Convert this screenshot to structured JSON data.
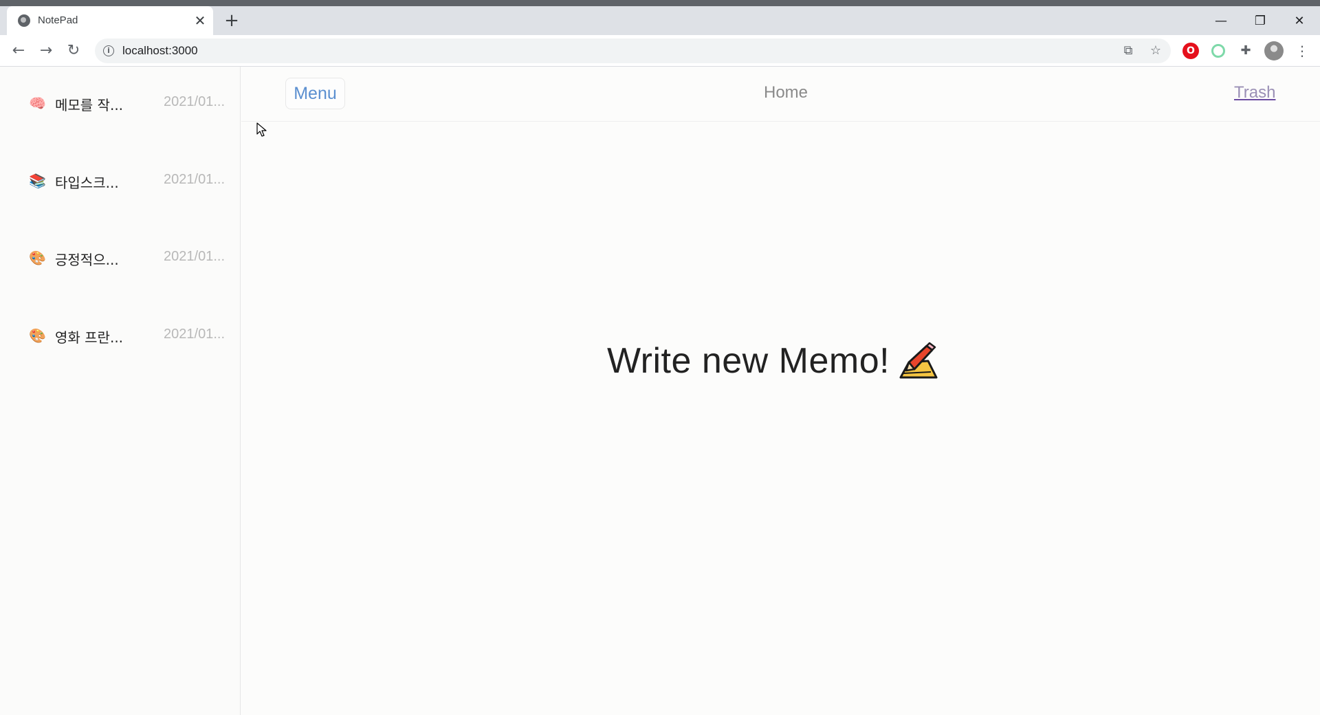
{
  "browser": {
    "tab_title": "NotePad",
    "tab_close": "✕",
    "new_tab": "+",
    "url": "localhost:3000",
    "nav": {
      "back": "←",
      "forward": "→",
      "reload": "↻"
    },
    "window_controls": {
      "minimize": "—",
      "restore": "❐",
      "close": "✕"
    },
    "info_glyph": "i",
    "translate_glyph": "⧉",
    "star_glyph": "☆",
    "opera_glyph": "O",
    "puzzle_glyph": "✚",
    "menu_glyph": "⋮"
  },
  "sidebar": {
    "memos": [
      {
        "emoji": "🧠",
        "title": "메모를 작...",
        "date": "2021/01..."
      },
      {
        "emoji": "📚",
        "title": "타입스크...",
        "date": "2021/01..."
      },
      {
        "emoji": "🎨",
        "title": "긍정적으...",
        "date": "2021/01..."
      },
      {
        "emoji": "🎨",
        "title": "영화 프란...",
        "date": "2021/01..."
      }
    ]
  },
  "header": {
    "menu_label": "Menu",
    "home_label": "Home",
    "trash_label": "Trash"
  },
  "main": {
    "hero_text": "Write new Memo!"
  },
  "colors": {
    "menu_accent": "#5b8fd0",
    "trash_underline": "#6b4aa0",
    "date_gray": "#b8b8b8"
  }
}
